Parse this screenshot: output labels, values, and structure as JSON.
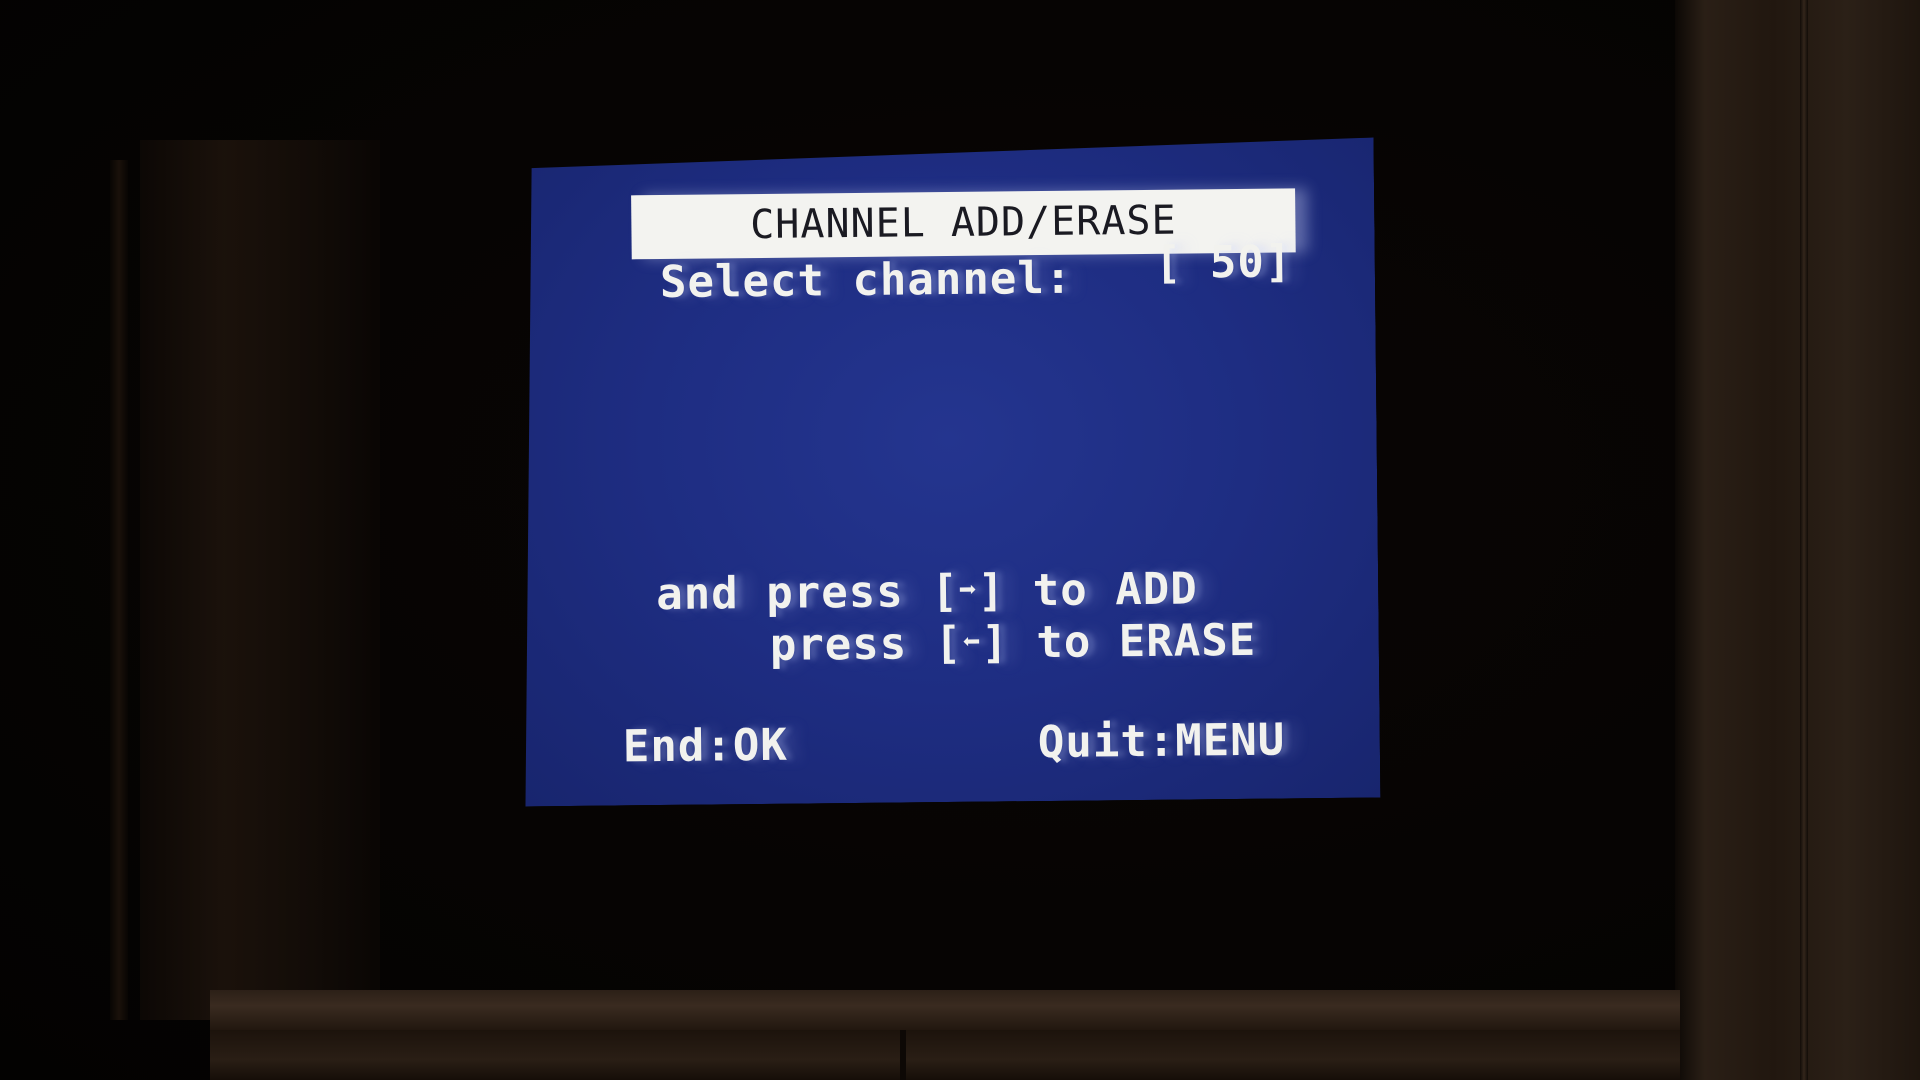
{
  "osd": {
    "title": "CHANNEL ADD/ERASE",
    "select_label": "Select channel:",
    "channel_value": "[ 50]",
    "add_prefix": "and press",
    "add_suffix": "to ADD",
    "erase_prefix": "press",
    "erase_suffix": "to ERASE",
    "bracket_open": "[",
    "bracket_close": "]",
    "end_label": "End:OK",
    "quit_label": "Quit:MENU"
  },
  "icons": {
    "add_arrow": "right-arrow-icon",
    "erase_arrow": "left-arrow-icon"
  },
  "colors": {
    "screen_blue": "#1e2d82",
    "text_white": "#f2f2ee",
    "title_bar": "#f3f3f0"
  }
}
